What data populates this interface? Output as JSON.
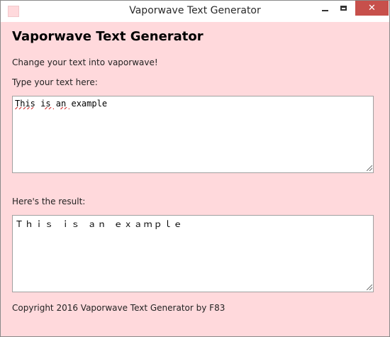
{
  "window": {
    "title": "Vaporwave Text Generator",
    "close_glyph": "✕"
  },
  "main": {
    "heading": "Vaporwave Text Generator",
    "intro": "Change your text into vaporwave!",
    "input_label": "Type your text here:",
    "input_value": "This is an example",
    "result_label": "Here's the result:",
    "result_value": "Ｔｈｉｓ ｉｓ ａｎ ｅｘａｍｐｌｅ",
    "footer": "Copyright 2016 Vaporwave Text Generator by F83"
  },
  "colors": {
    "background": "#ffd9dc",
    "close_button": "#c7504b"
  }
}
